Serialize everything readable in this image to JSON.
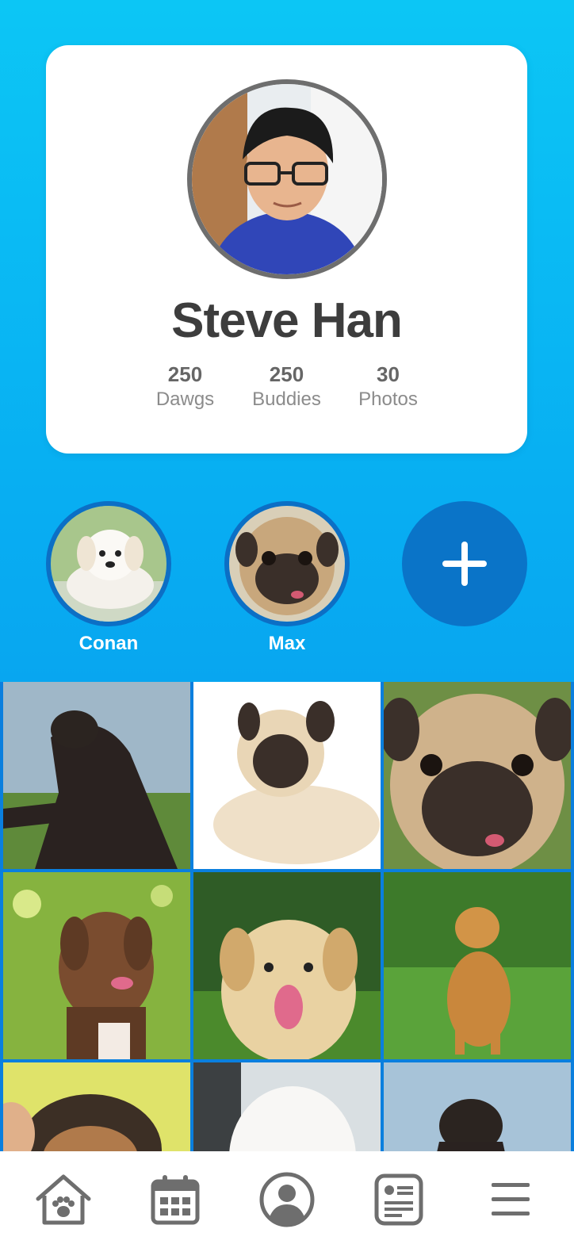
{
  "profile": {
    "name": "Steve Han",
    "stats": [
      {
        "value": "250",
        "label": "Dawgs"
      },
      {
        "value": "250",
        "label": "Buddies"
      },
      {
        "value": "30",
        "label": "Photos"
      }
    ]
  },
  "pets": [
    {
      "name": "Conan"
    },
    {
      "name": "Max"
    }
  ],
  "add_pet_icon": "plus-icon",
  "photo_count_visible": 9,
  "tabbar": {
    "items": [
      {
        "icon": "paw-house-icon"
      },
      {
        "icon": "calendar-icon"
      },
      {
        "icon": "profile-icon"
      },
      {
        "icon": "news-icon"
      },
      {
        "icon": "menu-icon"
      }
    ]
  },
  "colors": {
    "accent": "#0a74c8",
    "gradient_top": "#0cc6f5",
    "gradient_bottom": "#0a8eea",
    "icon_gray": "#6e6e6e"
  }
}
